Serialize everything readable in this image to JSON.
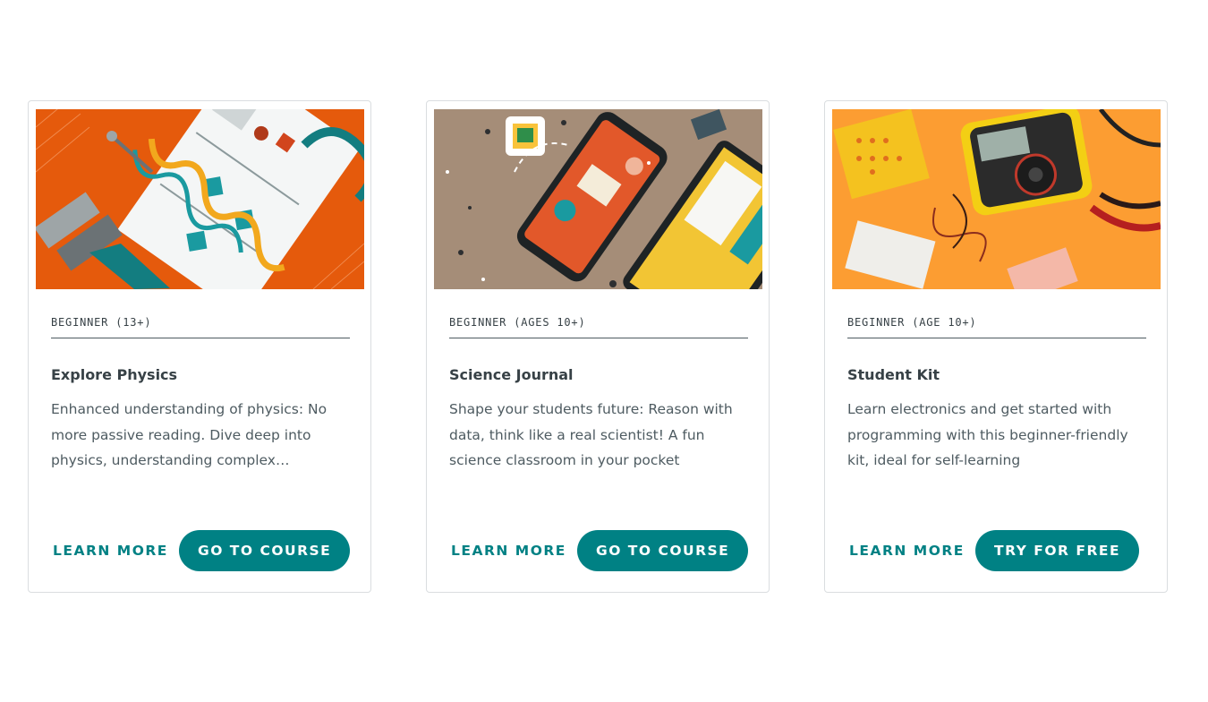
{
  "cards": [
    {
      "level": "BEGINNER (13+)",
      "title": "Explore Physics",
      "description": "Enhanced understanding of physics: No more passive reading. Dive deep into physics, understanding complex…",
      "learn_more": "LEARN MORE",
      "cta": "GO TO COURSE",
      "image_icon": "physics-kit-illustration"
    },
    {
      "level": "BEGINNER (AGES 10+)",
      "title": "Science Journal",
      "description": "Shape your students future: Reason with data, think like a real scientist! A fun science classroom in your pocket",
      "learn_more": "LEARN MORE",
      "cta": "GO TO COURSE",
      "image_icon": "science-journal-phone-illustration"
    },
    {
      "level": "BEGINNER (AGE 10+)",
      "title": "Student Kit",
      "description": "Learn electronics and get started with programming with this beginner-friendly kit, ideal for self-learning",
      "learn_more": "LEARN MORE",
      "cta": "TRY FOR FREE",
      "image_icon": "student-kit-multimeter-photo"
    }
  ],
  "colors": {
    "accent": "#008184",
    "text_dark": "#374146",
    "text_body": "#4e5b61",
    "card_border": "#dadde0"
  }
}
